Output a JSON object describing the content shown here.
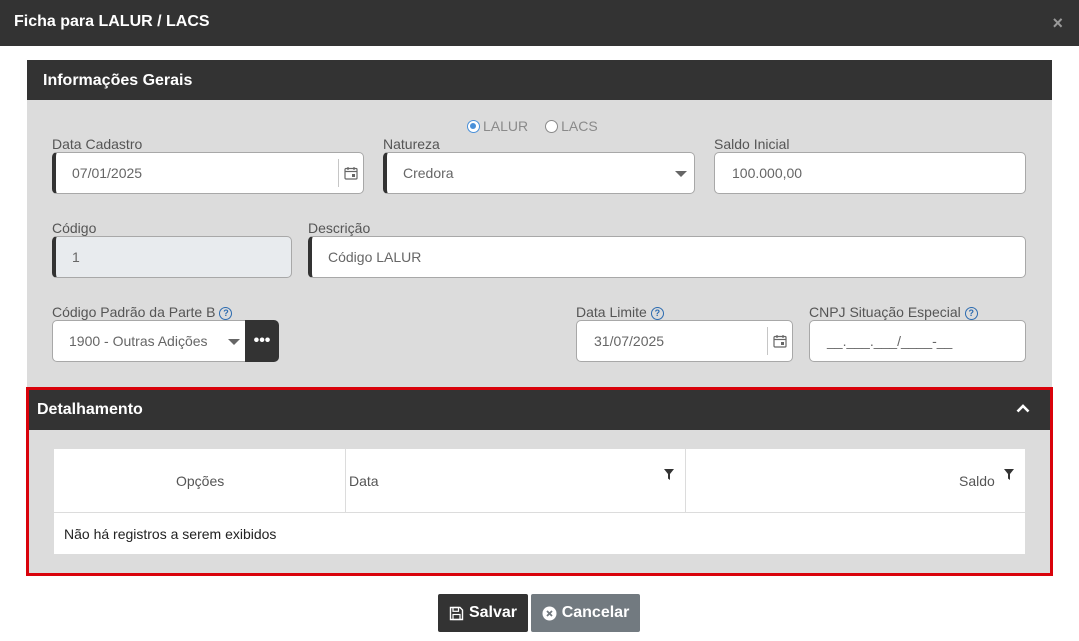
{
  "modal": {
    "title": "Ficha para LALUR / LACS",
    "close_glyph": "×"
  },
  "geral": {
    "title": "Informações Gerais",
    "radio": [
      {
        "label": "LALUR",
        "checked": true
      },
      {
        "label": "LACS",
        "checked": false
      }
    ],
    "data_cadastro": {
      "label": "Data Cadastro",
      "value": "07/01/2025",
      "icon": "calendar-icon"
    },
    "natureza": {
      "label": "Natureza",
      "value": "Credora"
    },
    "saldo_inicial": {
      "label": "Saldo Inicial",
      "value": "100.000,00"
    },
    "codigo": {
      "label": "Código",
      "value": "1"
    },
    "descricao": {
      "label": "Descrição",
      "value": "Código LALUR"
    },
    "codigo_padrao": {
      "label": "Código Padrão da Parte B",
      "value": "1900 - Outras Adições",
      "more_glyph": "•••"
    },
    "data_limite": {
      "label": "Data Limite",
      "value": "31/07/2025",
      "icon": "calendar-icon"
    },
    "cnpj": {
      "label": "CNPJ Situação Especial",
      "value": "__.___.___/____-__"
    },
    "help_glyph": "?"
  },
  "detalhamento": {
    "title": "Detalhamento",
    "columns": [
      "Opções",
      "Data",
      "Saldo"
    ],
    "empty_message": "Não há registros a serem exibidos"
  },
  "footer": {
    "save_label": "Salvar",
    "cancel_label": "Cancelar"
  },
  "colors": {
    "dark": "#333333",
    "panel": "#dcdcdc",
    "highlight_border": "#d9020b",
    "radio_accent": "#4a90d9",
    "cancel": "#727a80"
  }
}
